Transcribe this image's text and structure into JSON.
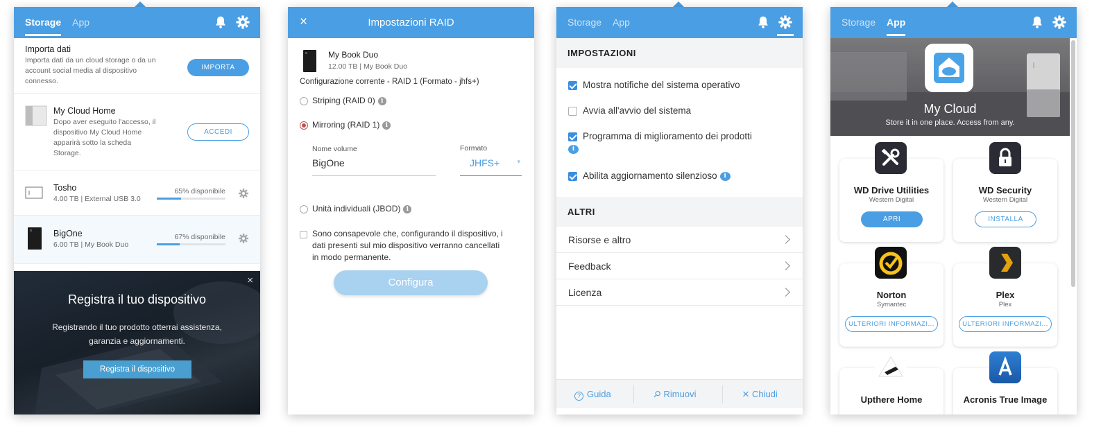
{
  "panel1": {
    "tabs": [
      "Storage",
      "App"
    ],
    "import": {
      "title": "Importa dati",
      "desc_lines": [
        "Importa dati da un cloud storage o da un",
        "account social media al dispositivo",
        "connesso."
      ],
      "button": "IMPORTA"
    },
    "mycloudhome": {
      "title": "My Cloud Home",
      "desc_lines": [
        "Dopo aver eseguito l'accesso, il",
        "dispositivo My Cloud Home",
        "apparirà sotto la scheda",
        "Storage."
      ],
      "button": "ACCEDI"
    },
    "devices": [
      {
        "name": "Tosho",
        "detail": "4.00 TB | External USB 3.0",
        "available": "65% disponibile",
        "used_fraction": 0.35
      },
      {
        "name": "BigOne",
        "detail": "6.00 TB | My Book Duo",
        "available": "67% disponibile",
        "used_fraction": 0.33
      }
    ],
    "promo": {
      "title": "Registra il tuo dispositivo",
      "text_lines": [
        "Registrando il tuo prodotto otterrai assistenza,",
        "garanzia e aggiornamenti."
      ],
      "button": "Registra il dispositivo"
    }
  },
  "panel2": {
    "title": "Impostazioni RAID",
    "device_name": "My Book Duo",
    "device_detail": "12.00 TB | My Book Duo",
    "current_config": "Configurazione corrente - RAID 1 (Formato - jhfs+)",
    "options": [
      "Striping (RAID 0)",
      "Mirroring (RAID 1)",
      "Unità individuali (JBOD)"
    ],
    "volume_label": "Nome volume",
    "volume_value": "BigOne",
    "format_label": "Formato",
    "format_value": "JHFS+",
    "ack_lines": [
      "Sono consapevole che, configurando il dispositivo, i",
      "dati presenti sul mio dispositivo verranno cancellati",
      "in modo permanente."
    ],
    "button": "Configura"
  },
  "panel3": {
    "tabs": [
      "Storage",
      "App"
    ],
    "settings_header": "IMPOSTAZIONI",
    "settings": [
      {
        "label": "Mostra notifiche del sistema operativo",
        "checked": true
      },
      {
        "label": "Avvia all'avvio del sistema",
        "checked": false
      },
      {
        "label": "Programma di miglioramento dei prodotti",
        "checked": true
      },
      {
        "label": "Abilita aggiornamento silenzioso",
        "checked": true
      }
    ],
    "others_header": "ALTRI",
    "links": [
      "Risorse e altro",
      "Feedback",
      "Licenza"
    ],
    "footer": [
      "Guida",
      "Rimuovi",
      "Chiudi"
    ]
  },
  "panel4": {
    "tabs": [
      "Storage",
      "App"
    ],
    "hero_title": "My Cloud",
    "hero_subtitle": "Store it in one place. Access from any.",
    "apps": [
      {
        "name": "WD Drive Utilities",
        "vendor": "Western Digital",
        "button": "APRI"
      },
      {
        "name": "WD Security",
        "vendor": "Western Digital",
        "button": "INSTALLA"
      },
      {
        "name": "Norton",
        "vendor": "Symantec",
        "button": "ULTERIORI INFORMAZI..."
      },
      {
        "name": "Plex",
        "vendor": "Plex",
        "button": "ULTERIORI INFORMAZI..."
      },
      {
        "name": "Upthere Home",
        "vendor": "",
        "button": ""
      },
      {
        "name": "Acronis True Image",
        "vendor": "",
        "button": ""
      }
    ]
  },
  "colors": {
    "accent": "#4a9ee3",
    "danger_radio": "#c0504d"
  }
}
